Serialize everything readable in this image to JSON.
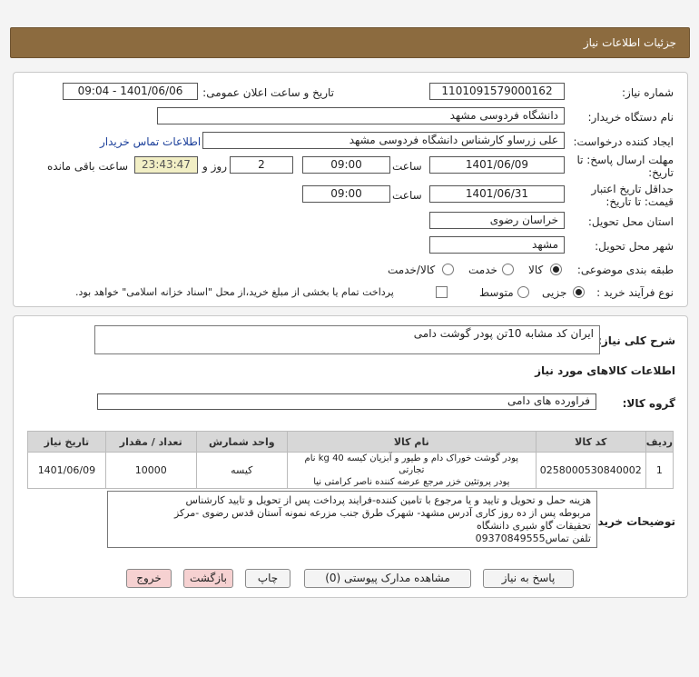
{
  "page": {
    "title": "جزئیات اطلاعات نیاز"
  },
  "form": {
    "need_no_label": "شماره نیاز:",
    "need_no": "1101091579000162",
    "pub_label": "تاریخ و ساعت اعلان عمومی:",
    "pub_value": "1401/06/06 - 09:04",
    "buyer_label": "نام دستگاه خریدار:",
    "buyer": "دانشگاه فردوسی مشهد",
    "creator_label": "ایجاد کننده درخواست:",
    "creator": "علی زرساو کارشناس دانشگاه فردوسی مشهد",
    "contact_link": "اطلاعات تماس خریدار",
    "deadline_label_1": "مهلت ارسال پاسخ: تا",
    "deadline_label_2": "تاریخ:",
    "deadline_date": "1401/06/09",
    "time_label": "ساعت",
    "deadline_time": "09:00",
    "days": "2",
    "days_label": "روز و",
    "remaining": "23:43:47",
    "remaining_label": "ساعت باقی مانده",
    "validity_label_1": "حداقل تاریخ اعتبار",
    "validity_label_2": "قیمت: تا تاریخ:",
    "validity_date": "1401/06/31",
    "validity_time": "09:00",
    "province_label": "استان محل تحویل:",
    "province": "خراسان رضوی",
    "city_label": "شهر محل تحویل:",
    "city": "مشهد",
    "category_label": "طبقه بندی موضوعی:",
    "category_options": [
      "کالا",
      "خدمت",
      "کالا/خدمت"
    ],
    "process_label": "نوع فرآیند خرید :",
    "process_options": [
      "جزیی",
      "متوسط"
    ],
    "process_note": "پرداخت تمام یا بخشی از مبلغ خرید،از محل \"اسناد خزانه اسلامی\" خواهد بود."
  },
  "desc": {
    "label": "شرح کلی نیاز:",
    "value": "ایران کد مشابه 10تن پودر گوشت دامی"
  },
  "goods": {
    "section_title": "اطلاعات کالاهای مورد نیاز",
    "group_label": "گروه کالا:",
    "group_value": "فراورده های دامی",
    "headers": [
      "ردیف",
      "کد کالا",
      "نام کالا",
      "واحد شمارش",
      "تعداد / مقدار",
      "تاریخ نیاز"
    ],
    "rows": [
      {
        "idx": "1",
        "code": "0258000530840002",
        "name_1": "پودر گوشت خوراک دام و طیور و آبزیان کیسه 40 kg نام تجارتی",
        "name_2": "پودر پروتئین خزر مرجع عرضه کننده ناصر کرامتی نیا",
        "unit": "کیسه",
        "qty": "10000",
        "date": "1401/06/09"
      }
    ]
  },
  "notes": {
    "label": "توضیحات خریدار:",
    "lines": [
      "هزینه حمل و تحویل و تایید و یا مرجوع با تامین کننده-فرایند پرداخت پس از تحویل و تایید کارشناس",
      "مربوطه پس از ده روز کاری آدرس مشهد- شهرک طرق جنب مزرعه نمونه آستان قدس رضوی -مرکز",
      "تحقیقات گاو شیری دانشگاه",
      "تلفن تماس09370849555"
    ]
  },
  "buttons": {
    "reply": "پاسخ به نیاز",
    "docs": "مشاهده مدارک پیوستی (0)",
    "print": "چاپ",
    "back": "بازگشت",
    "exit": "خروج"
  }
}
